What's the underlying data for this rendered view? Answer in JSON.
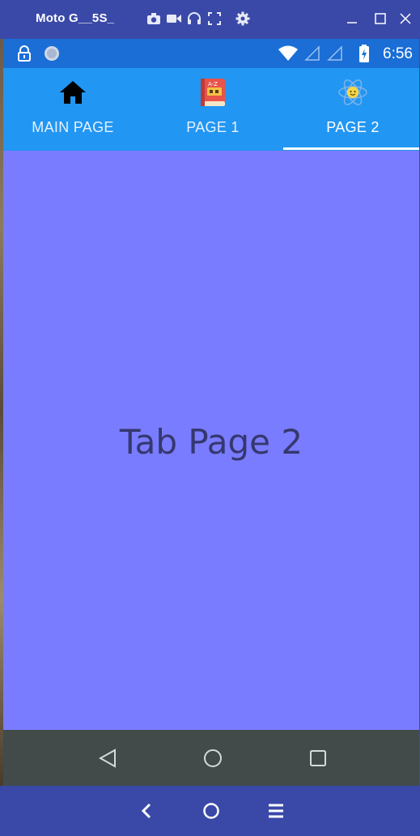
{
  "window": {
    "title": "Moto G__5S_",
    "controls": [
      "minimize",
      "maximize",
      "close"
    ]
  },
  "toolbar": {
    "icons": [
      "camera-icon",
      "video-icon",
      "headphones-icon",
      "fullscreen-icon",
      "settings-icon"
    ]
  },
  "status_bar": {
    "time": "6:56",
    "icons": [
      "lock-icon",
      "sync-icon",
      "wifi-icon",
      "signal-icon",
      "signal-icon",
      "battery-charging-icon"
    ]
  },
  "tabs": [
    {
      "label": "MAIN PAGE",
      "icon": "home-icon",
      "selected": false
    },
    {
      "label": "PAGE 1",
      "icon": "book-icon",
      "selected": false
    },
    {
      "label": "PAGE 2",
      "icon": "atom-icon",
      "selected": true
    }
  ],
  "content": {
    "text": "Tab Page 2",
    "background": "#7a7cff"
  },
  "nav_bar": {
    "buttons": [
      "back-icon",
      "home-circle-icon",
      "recents-icon"
    ]
  },
  "emulator_bottom": {
    "buttons": [
      "chevron-left-icon",
      "circle-icon",
      "menu-icon"
    ]
  },
  "colors": {
    "tab_bar": "#2196f3",
    "status_bar": "#1a6ed6",
    "emulator_frame": "#3a49a8",
    "nav_bar": "#434a4a"
  }
}
